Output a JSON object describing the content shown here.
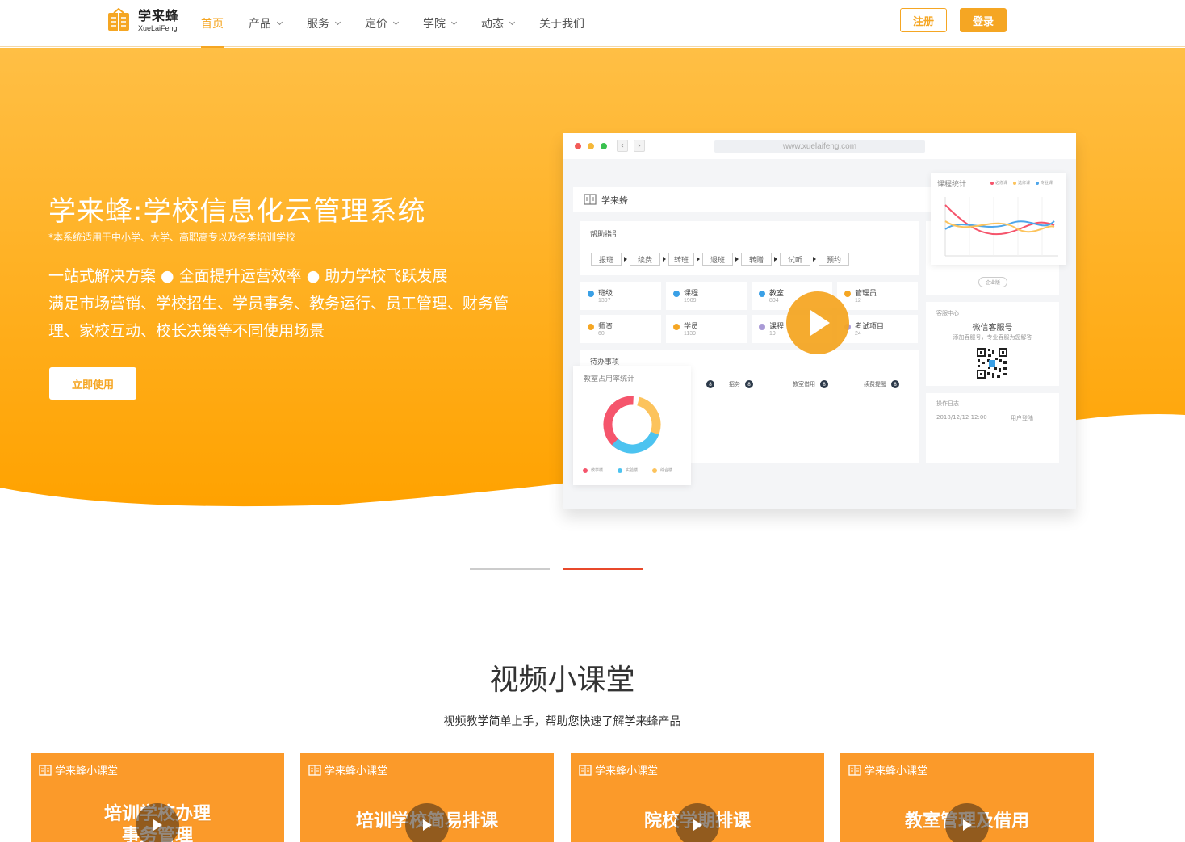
{
  "header": {
    "logo_cn": "学来蜂",
    "logo_en": "XueLaiFeng",
    "nav": [
      {
        "label": "首页",
        "active": true,
        "dropdown": false
      },
      {
        "label": "产品",
        "active": false,
        "dropdown": true
      },
      {
        "label": "服务",
        "active": false,
        "dropdown": true
      },
      {
        "label": "定价",
        "active": false,
        "dropdown": true
      },
      {
        "label": "学院",
        "active": false,
        "dropdown": true
      },
      {
        "label": "动态",
        "active": false,
        "dropdown": true
      },
      {
        "label": "关于我们",
        "active": false,
        "dropdown": false
      }
    ],
    "register_label": "注册",
    "login_label": "登录"
  },
  "hero": {
    "title": "学来蜂:学校信息化云管理系统",
    "note": "*本系统适用于中小学、大学、高职高专以及各类培训学校",
    "points": "一站式解决方案 ● 全面提升运营效率 ● 助力学校飞跃发展",
    "description": "满足市场营销、学校招生、学员事务、教务运行、员工管理、财务管理、家校互动、校长决策等不同使用场景",
    "cta_label": "立即使用",
    "mockup": {
      "url": "www.xuelaifeng.com",
      "app_name": "学来蜂",
      "guide_title": "帮助指引",
      "flow": [
        "报班",
        "续费",
        "转班",
        "退班",
        "转赠",
        "试听",
        "预约"
      ],
      "stats": [
        {
          "label": "班级",
          "value": "1397",
          "color": "#3aa0e6"
        },
        {
          "label": "课程",
          "value": "1909",
          "color": "#3aa0e6"
        },
        {
          "label": "教室",
          "value": "804",
          "color": "#3aa0e6"
        },
        {
          "label": "管理员",
          "value": "12",
          "color": "#f5a623"
        },
        {
          "label": "师资",
          "value": "60",
          "color": "#f5a623"
        },
        {
          "label": "学员",
          "value": "1139",
          "color": "#f5a623"
        },
        {
          "label": "课程",
          "value": "19",
          "color": "#a99ad6"
        },
        {
          "label": "考试项目",
          "value": "24",
          "color": "#a99ad6"
        }
      ],
      "todo_title": "待办事项",
      "todo_items": [
        "招务",
        "教室借用",
        "续费提醒"
      ],
      "todo_badge": "8",
      "course_chart_title": "课程统计",
      "course_legend": [
        "必修课",
        "选修课",
        "专业课"
      ],
      "edition_label": "企业版",
      "service_title": "客服中心",
      "wechat_title": "微信客服号",
      "wechat_desc": "添加客服号，专业客服为您解答",
      "log_title": "操作日志",
      "log_time": "2018/12/12 12:00",
      "log_event": "用户登陆",
      "room_chart_title": "教室占用率统计",
      "room_legend": [
        "教学楼",
        "实验楼",
        "综合楼"
      ]
    }
  },
  "carousel": {
    "count": 2,
    "active_index": 1
  },
  "video_section": {
    "title": "视频小课堂",
    "subtitle": "视频教学简单上手，帮助您快速了解学来蜂产品",
    "card_brand": "学来蜂小课堂",
    "cards": [
      {
        "line1": "培训学校办理",
        "line2": "事务管理"
      },
      {
        "line1": "培训学校简易排课",
        "line2": ""
      },
      {
        "line1": "院校学期排课",
        "line2": ""
      },
      {
        "line1": "教室管理及借用",
        "line2": ""
      }
    ]
  },
  "colors": {
    "brand": "#f5a623",
    "hero_top": "#ffbf45",
    "hero_bottom": "#ffa500",
    "card": "#fb9a2a",
    "indicator_active": "#e8492b",
    "indicator_inactive": "#cccccc"
  }
}
